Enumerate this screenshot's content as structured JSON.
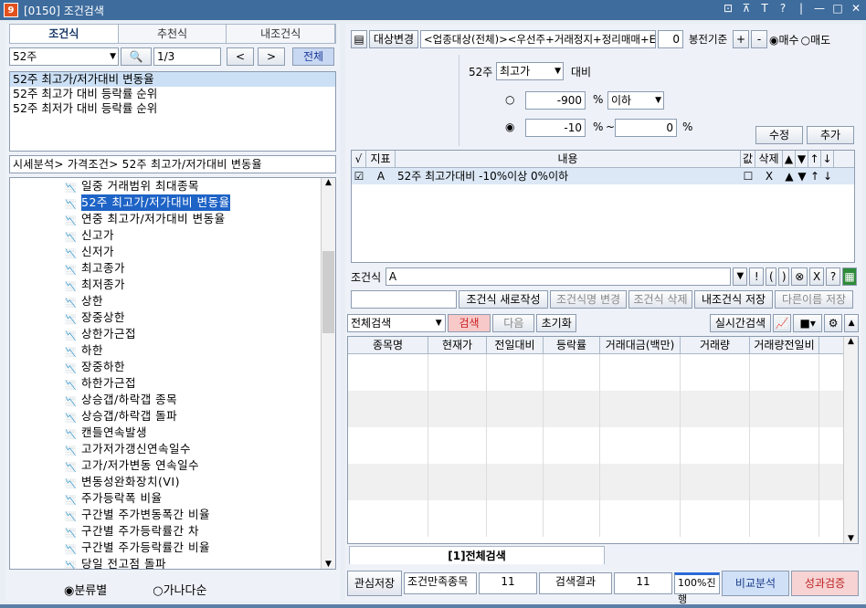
{
  "window": {
    "title": "[0150] 조건검색",
    "app_icon": "9"
  },
  "title_buttons": [
    "⊡",
    "⊼",
    "T",
    "?",
    "|",
    "—",
    "□",
    "✕"
  ],
  "left": {
    "tabs": [
      "조건식",
      "추천식",
      "내조건식"
    ],
    "search_value": "52주",
    "page": "1/3",
    "prev": "<",
    "next": ">",
    "all": "전체",
    "results": [
      "52주 최고가/저가대비 변동율",
      "52주 최고가 대비 등락률 순위",
      "52주 최저가 대비 등락률 순위"
    ],
    "path": "시세분석> 가격조건> 52주 최고가/저가대비 변동율",
    "tree": [
      "일중 거래범위 최대종목",
      "52주 최고가/저가대비 변동율",
      "연중 최고가/저가대비 변동율",
      "신고가",
      "신저가",
      "최고종가",
      "최저종가",
      "상한",
      "장중상한",
      "상한가근접",
      "하한",
      "장중하한",
      "하한가근접",
      "상승갭/하락갭 종목",
      "상승갭/하락갭 돌파",
      "캔들연속발생",
      "고가저가갱신연속일수",
      "고가/저가변동 연속일수",
      "변동성완화장치(VI)",
      "주가등락폭 비율",
      "구간별 주가변동폭간 비율",
      "구간별 주가등락률간 차",
      "구간별 주가등락률간 비율",
      "당일 전고점 돌파"
    ],
    "sort_options": [
      "분류별",
      "가나다순"
    ]
  },
  "right": {
    "toolbar": {
      "change_label": "대상변경",
      "target": "<업종대상(전체)><우선주+거래정지+정리매매+E",
      "spin_value": "0",
      "basis": "봉전기준",
      "plus": "+",
      "minus": "-",
      "opt_buy": "매수",
      "opt_sell": "매도"
    },
    "cond": {
      "week_label": "52주",
      "price_select": "최고가",
      "vs_label": "대비",
      "val1": "-900",
      "pct": "%",
      "below": "이하",
      "val2": "-10",
      "tilde": "~",
      "val3": "0",
      "edit": "수정",
      "add": "추가"
    },
    "cond_grid": {
      "headers": [
        "√",
        "지표",
        "내용",
        "값",
        "삭제",
        "▲",
        "▼",
        "↑",
        "↓"
      ],
      "row": {
        "idx": "A",
        "content": "52주 최고가대비 -10%이상 0%이하",
        "del": "X",
        "up": "▲",
        "down": "▼",
        "top": "↑",
        "bot": "↓"
      }
    },
    "formula": {
      "label": "조건식",
      "value": "A",
      "btns": [
        "▼",
        "!",
        "(",
        ")",
        "⊗",
        "X",
        "?"
      ]
    },
    "save_row": {
      "new": "조건식 새로작성",
      "rename": "조건식명 변경",
      "delete": "조건식 삭제",
      "save": "내조건식 저장",
      "save_as": "다른이름 저장"
    },
    "search_row": {
      "mode": "전체검색",
      "search": "검색",
      "next": "다음",
      "reset": "초기화",
      "realtime": "실시간검색"
    },
    "result_headers": [
      "종목명",
      "현재가",
      "전일대비",
      "등락률",
      "거래대금(백만)",
      "거래량",
      "거래량전일비"
    ],
    "result_tab": "[1]전체검색",
    "status": {
      "save": "관심저장",
      "label1": "조건만족종목",
      "val1": "11",
      "label2": "검색결과",
      "val2": "11",
      "progress": "100%진행",
      "compare": "비교분석",
      "verify": "성과검증"
    }
  }
}
